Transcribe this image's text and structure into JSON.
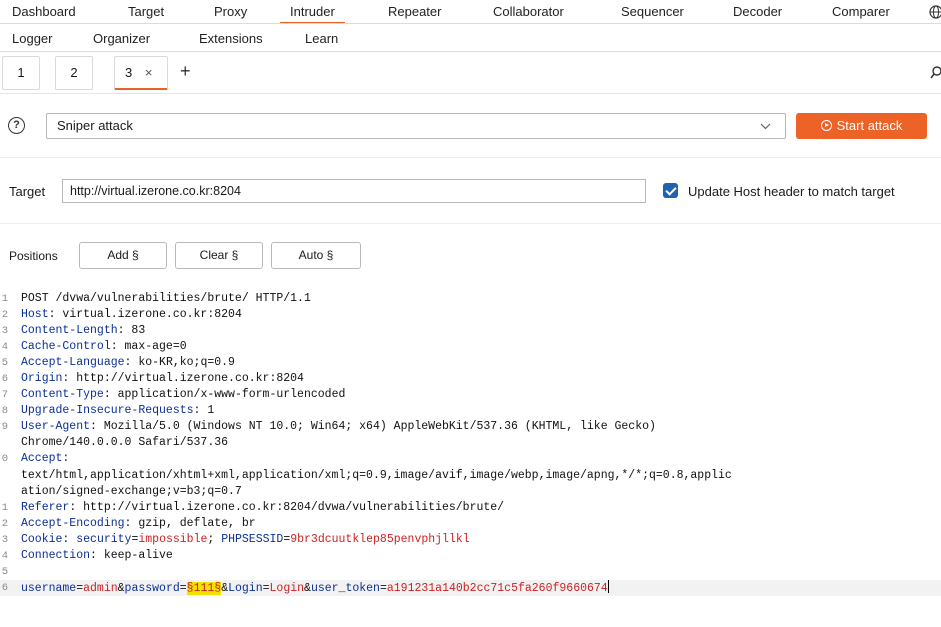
{
  "nav": {
    "row1": [
      "Dashboard",
      "Target",
      "Proxy",
      "Intruder",
      "Repeater",
      "Collaborator",
      "Sequencer",
      "Decoder",
      "Comparer"
    ],
    "row2": [
      "Logger",
      "Organizer",
      "Extensions",
      "Learn"
    ],
    "active": "Intruder",
    "globe_icon": "globe-icon"
  },
  "tabs": {
    "items": [
      "1",
      "2",
      "3"
    ],
    "active": "3",
    "close_glyph": "×",
    "add_glyph": "+",
    "search_icon": "search-icon"
  },
  "attack": {
    "help_glyph": "?",
    "attack_type": "Sniper attack",
    "start_label": "Start attack"
  },
  "target": {
    "label": "Target",
    "url": "http://virtual.izerone.co.kr:8204",
    "checkbox_checked": true,
    "checkbox_label": "Update Host header to match target"
  },
  "positions": {
    "label": "Positions",
    "add": "Add §",
    "clear": "Clear §",
    "auto": "Auto §"
  },
  "request": {
    "lines": [
      {
        "num": "1",
        "text": "POST /dvwa/vulnerabilities/brute/ HTTP/1.1"
      },
      {
        "num": "2",
        "key": "Host",
        "value": " virtual.izerone.co.kr:8204"
      },
      {
        "num": "3",
        "key": "Content-Length",
        "value": " 83"
      },
      {
        "num": "4",
        "key": "Cache-Control",
        "value": " max-age=0"
      },
      {
        "num": "5",
        "key": "Accept-Language",
        "value": " ko-KR,ko;q=0.9"
      },
      {
        "num": "6",
        "key": "Origin",
        "value": " http://virtual.izerone.co.kr:8204"
      },
      {
        "num": "7",
        "key": "Content-Type",
        "value": " application/x-www-form-urlencoded"
      },
      {
        "num": "8",
        "key": "Upgrade-Insecure-Requests",
        "value": " 1"
      },
      {
        "num": "9",
        "key": "User-Agent",
        "value": " Mozilla/5.0 (Windows NT 10.0; Win64; x64) AppleWebKit/537.36 (KHTML, like Gecko)"
      },
      {
        "num": "",
        "text": "Chrome/140.0.0.0 Safari/537.36"
      },
      {
        "num": "0",
        "key": "Accept",
        "value": ""
      },
      {
        "num": "",
        "text": "text/html,application/xhtml+xml,application/xml;q=0.9,image/avif,image/webp,image/apng,*/*;q=0.8,applic"
      },
      {
        "num": "",
        "text": "ation/signed-exchange;v=b3;q=0.7"
      },
      {
        "num": "1",
        "key": "Referer",
        "value": " http://virtual.izerone.co.kr:8204/dvwa/vulnerabilities/brute/"
      },
      {
        "num": "2",
        "key": "Accept-Encoding",
        "value": " gzip, deflate, br"
      },
      {
        "num": "3",
        "key": "Cookie",
        "cookie": [
          [
            "security",
            "impossible"
          ],
          [
            "PHPSESSID",
            "9br3dcuutklep85penvphjllkl"
          ]
        ]
      },
      {
        "num": "4",
        "key": "Connection",
        "value": " keep-alive"
      },
      {
        "num": "5",
        "text": ""
      },
      {
        "num": "6",
        "body": true
      }
    ],
    "body": {
      "username_key": "username",
      "username_val": "admin",
      "password_key": "password",
      "password_marker": "§111§",
      "login_key": "Login",
      "login_val": "Login",
      "token_key": "user_token",
      "token_val": "a191231a140b2cc71c5fa260f9660674"
    }
  }
}
